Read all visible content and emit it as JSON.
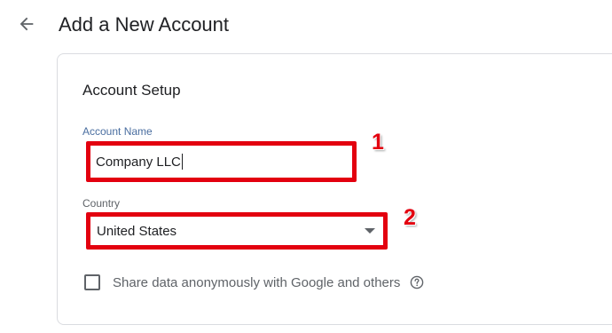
{
  "header": {
    "title": "Add a New Account",
    "back_icon": "arrow-back-icon"
  },
  "account_setup": {
    "section_title": "Account Setup",
    "account_name": {
      "label": "Account Name",
      "value": "Company LLC"
    },
    "country": {
      "label": "Country",
      "selected": "United States"
    },
    "share_data": {
      "label": "Share data anonymously with Google and others",
      "checked": false,
      "help_icon": "help-circle-icon"
    }
  },
  "annotations": {
    "step_1": "1",
    "step_2": "2",
    "highlight_color": "#e3000f"
  }
}
